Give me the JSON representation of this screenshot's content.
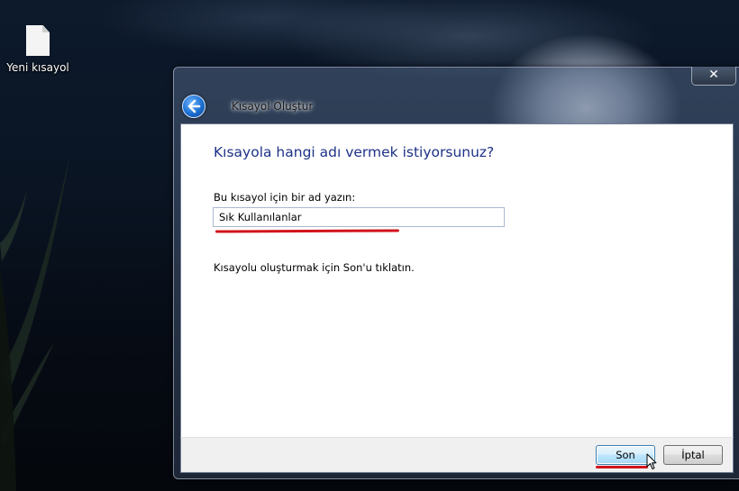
{
  "desktop": {
    "icon_label": "Yeni kısayol"
  },
  "window": {
    "title": "Kısayol Oluştur",
    "close_symbol": "✕",
    "heading": "Kısayola hangi adı vermek istiyorsunuz?",
    "field_label": "Bu kısayol için bir ad yazın:",
    "name_value": "Sık Kullanılanlar",
    "hint": "Kısayolu oluşturmak için Son'u tıklatın.",
    "buttons": {
      "finish": "Son",
      "cancel": "İptal"
    }
  },
  "colors": {
    "heading": "#1e3287",
    "annotation_underline": "#d2141c",
    "default_button_border": "#3c7fb1"
  },
  "icons": [
    "file-icon",
    "back-arrow-icon",
    "close-icon",
    "mouse-cursor-icon"
  ]
}
